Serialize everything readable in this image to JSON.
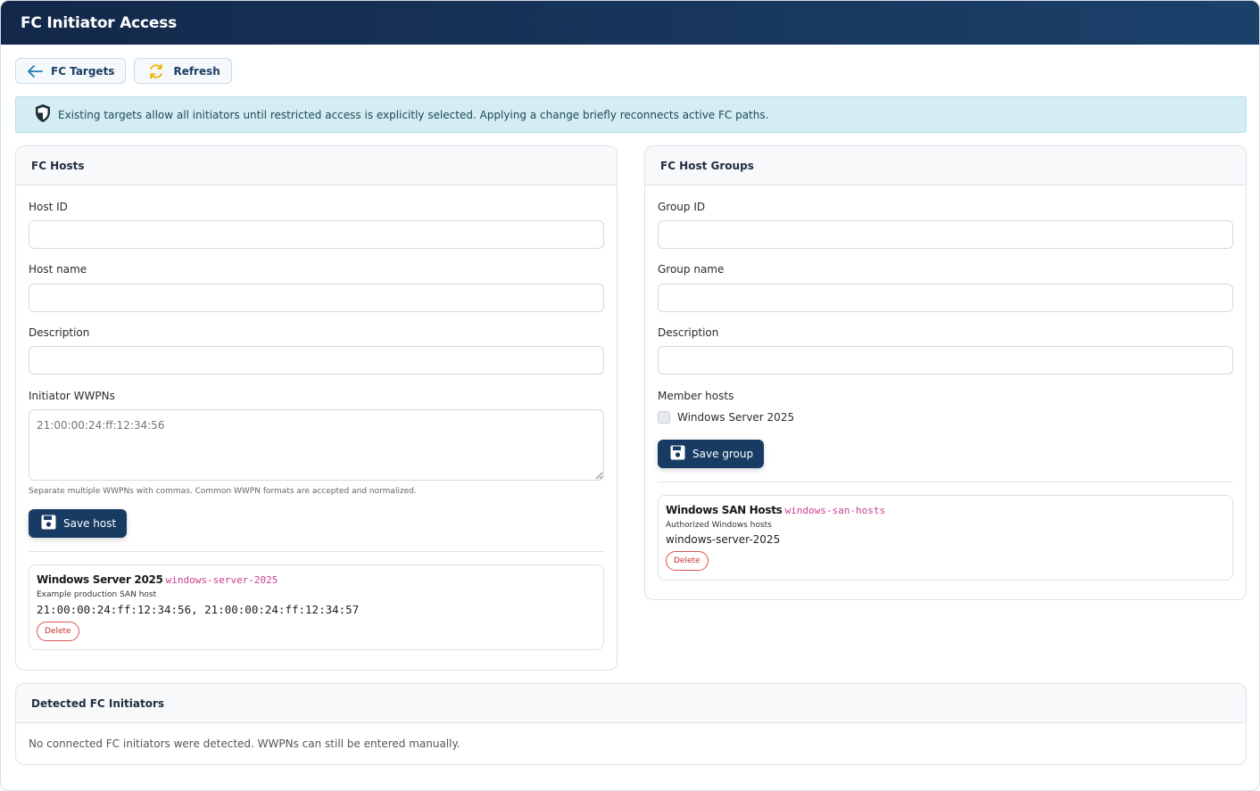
{
  "app": {
    "title": "FC Initiator Access"
  },
  "toolbar": {
    "back_label": "FC Targets",
    "refresh_label": "Refresh"
  },
  "alert": {
    "text": "Existing targets allow all initiators until restricted access is explicitly selected. Applying a change briefly reconnects active FC paths."
  },
  "hosts": {
    "title": "FC Hosts",
    "host_id_label": "Host ID",
    "host_id_value": "",
    "host_name_label": "Host name",
    "host_name_value": "",
    "description_label": "Description",
    "description_value": "",
    "wwpn_label": "Initiator WWPNs",
    "wwpn_placeholder": "21:00:00:24:ff:12:34:56",
    "wwpn_hint": "Separate multiple WWPNs with commas. Common WWPN formats are accepted and normalized.",
    "save_label": "Save host",
    "items": [
      {
        "name": "Windows Server 2025",
        "id": "windows-server-2025",
        "description": "Example production SAN host",
        "wwpns": "21:00:00:24:ff:12:34:56, 21:00:00:24:ff:12:34:57",
        "delete_label": "Delete"
      }
    ]
  },
  "groups": {
    "title": "FC Host Groups",
    "group_id_label": "Group ID",
    "group_id_value": "",
    "group_name_label": "Group name",
    "group_name_value": "",
    "description_label": "Description",
    "description_value": "",
    "members_label": "Member hosts",
    "member_options": [
      {
        "label": "Windows Server 2025",
        "checked": false
      }
    ],
    "save_label": "Save group",
    "items": [
      {
        "name": "Windows SAN Hosts",
        "id": "windows-san-hosts",
        "description": "Authorized Windows hosts",
        "members": "windows-server-2025",
        "delete_label": "Delete"
      }
    ]
  },
  "detected": {
    "title": "Detected FC Initiators",
    "empty_text": "No connected FC initiators were detected. WWPNs can still be entered manually."
  },
  "colors": {
    "header": "#173b63",
    "alert_bg": "#d3edf2",
    "accent_code": "#c93f8f",
    "danger": "#d9534f"
  }
}
